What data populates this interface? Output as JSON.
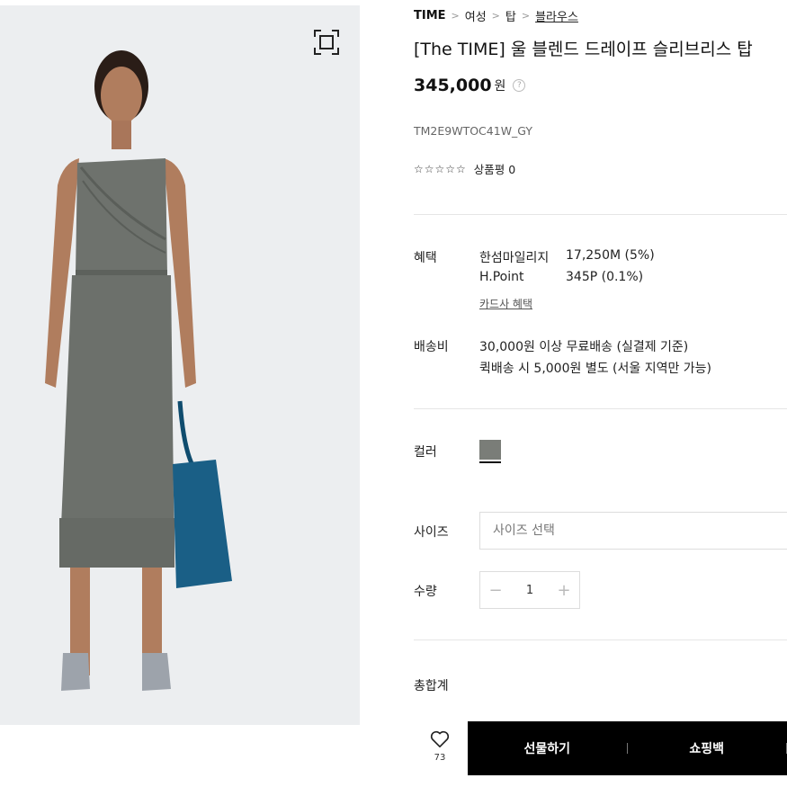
{
  "breadcrumb": {
    "brand": "TIME",
    "items": [
      "여성",
      "탑",
      "블라우스"
    ]
  },
  "product": {
    "title": "[The TIME] 울 블렌드 드레이프 슬리브리스 탑",
    "price": "345,000",
    "currency": "원",
    "price_help": "?",
    "code": "TM2E9WTOC41W_GY",
    "stars": "☆☆☆☆☆",
    "review_label": "상품평 0"
  },
  "benefit": {
    "label": "혜택",
    "rows": [
      {
        "name": "한섬마일리지",
        "value": "17,250M (5%)"
      },
      {
        "name": "H.Point",
        "value": "345P (0.1%)"
      }
    ],
    "card_link": "카드사 혜택"
  },
  "shipping": {
    "label": "배송비",
    "lines": [
      "30,000원 이상 무료배송 (실결제 기준)",
      "퀵배송 시 5,000원 별도 (서울 지역만 가능)"
    ]
  },
  "color": {
    "label": "컬러",
    "swatch": "#7a7d78"
  },
  "size": {
    "label": "사이즈",
    "placeholder": "사이즈 선택"
  },
  "quantity": {
    "label": "수량",
    "value": "1",
    "minus": "−",
    "plus": "+"
  },
  "total": {
    "label": "총합계"
  },
  "wishlist": {
    "count": "73"
  },
  "actions": {
    "gift": "선물하기",
    "cart": "쇼핑백"
  },
  "colors": {
    "background_photo": "#eceef0",
    "action_bar": "#000000"
  }
}
